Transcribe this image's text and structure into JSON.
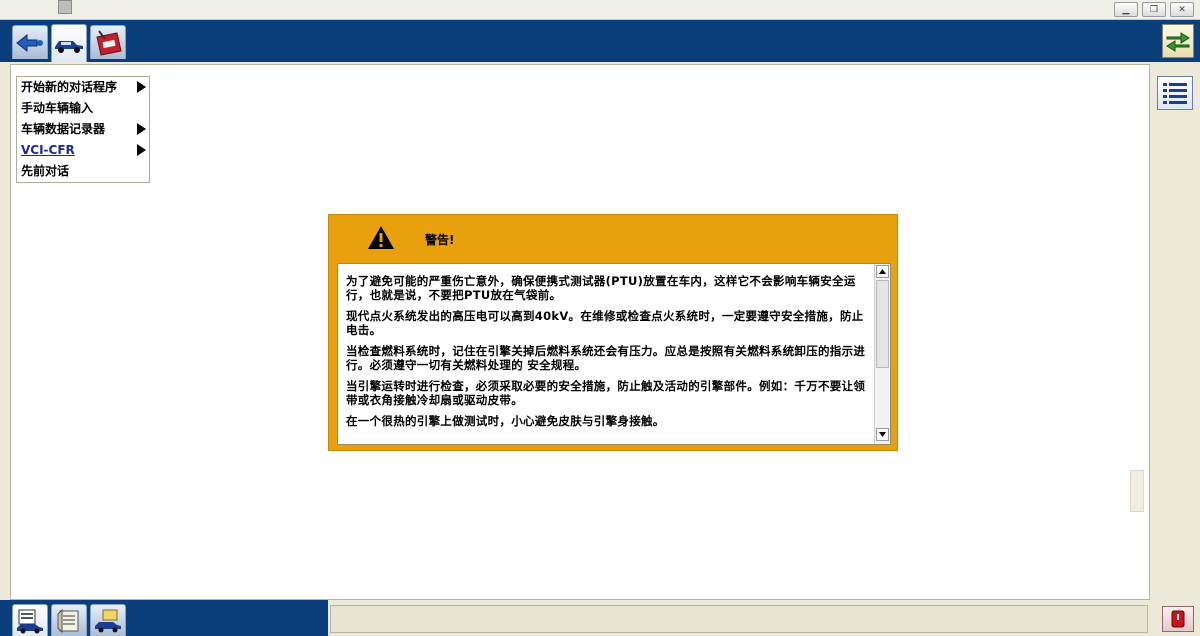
{
  "menu": {
    "items": [
      {
        "label": "开始新的对话程序",
        "has_submenu": true
      },
      {
        "label": "手动车辆输入",
        "has_submenu": false
      },
      {
        "label": "车辆数据记录器",
        "has_submenu": true
      },
      {
        "label": "VCI-CFR",
        "has_submenu": true
      },
      {
        "label": "先前对话",
        "has_submenu": false
      }
    ]
  },
  "dialog": {
    "title": "警告!",
    "paragraphs": [
      "为了避免可能的严重伤亡意外，确保便携式测试器(PTU)放置在车内，这样它不会影响车辆安全运行，也就是说，不要把PTU放在气袋前。",
      "现代点火系统发出的高压电可以高到40kV。在维修或检查点火系统时，一定要遵守安全措施，防止电击。",
      "当检查燃料系统时，记住在引擎关掉后燃料系统还会有压力。应总是按照有关燃料系统卸压的指示进行。必须遵守一切有关燃料处理的 安全规程。",
      "当引擎运转时进行检查，必须采取必要的安全措施，防止触及活动的引擎部件。例如：千万不要让领带或衣角接触冷却扇或驱动皮带。",
      "在一个很热的引擎上做测试时，小心避免皮肤与引擎身接触。"
    ]
  },
  "toolbar": {
    "icons": [
      "connect-icon",
      "vehicle-icon",
      "toolbox-icon"
    ],
    "right_icon": "swap-arrows-icon"
  },
  "bottom": {
    "icons": [
      "vehicle-info-icon",
      "document-icon",
      "vehicle-folder-icon"
    ],
    "stop_icon": "stop-icon"
  },
  "colors": {
    "toolbar_blue": "#0a3f7c",
    "dialog_orange": "#e8a00d",
    "link_blue": "#1a2a9a"
  }
}
